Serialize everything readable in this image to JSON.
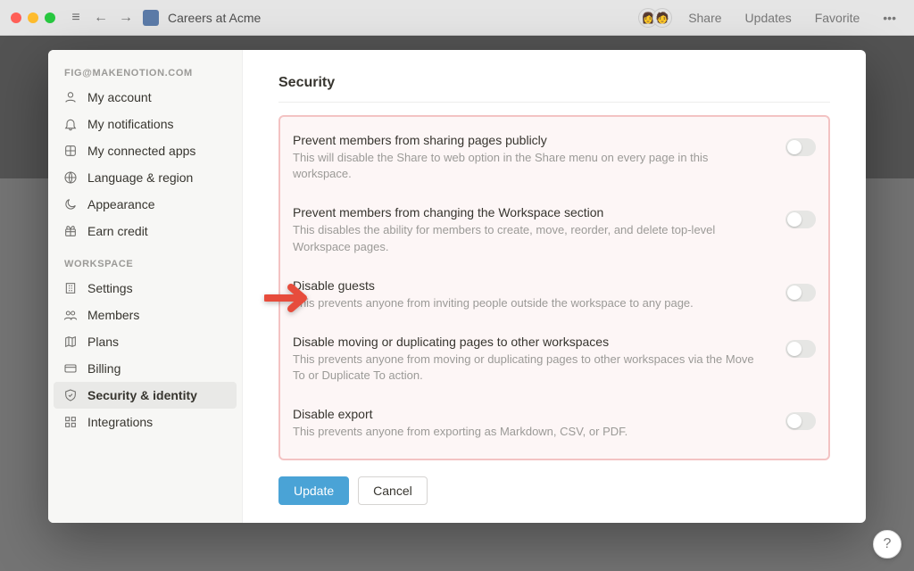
{
  "topbar": {
    "page_title": "Careers at Acme",
    "share": "Share",
    "updates": "Updates",
    "favorite": "Favorite"
  },
  "sidebar": {
    "account_header": "FIG@MAKENOTION.COM",
    "account_items": [
      {
        "icon": "user-circle-icon",
        "label": "My account"
      },
      {
        "icon": "bell-icon",
        "label": "My notifications"
      },
      {
        "icon": "app-grid-icon",
        "label": "My connected apps"
      },
      {
        "icon": "globe-icon",
        "label": "Language & region"
      },
      {
        "icon": "moon-icon",
        "label": "Appearance"
      },
      {
        "icon": "gift-icon",
        "label": "Earn credit"
      }
    ],
    "workspace_header": "WORKSPACE",
    "workspace_items": [
      {
        "icon": "building-icon",
        "label": "Settings"
      },
      {
        "icon": "people-icon",
        "label": "Members"
      },
      {
        "icon": "map-icon",
        "label": "Plans"
      },
      {
        "icon": "card-icon",
        "label": "Billing"
      },
      {
        "icon": "shield-icon",
        "label": "Security & identity"
      },
      {
        "icon": "integration-icon",
        "label": "Integrations"
      }
    ]
  },
  "main": {
    "title": "Security",
    "settings": [
      {
        "title": "Prevent members from sharing pages publicly",
        "desc": "This will disable the Share to web option in the Share menu on every page in this workspace.",
        "on": false
      },
      {
        "title": "Prevent members from changing the Workspace section",
        "desc": "This disables the ability for members to create, move, reorder, and delete top-level Workspace pages.",
        "on": false
      },
      {
        "title": "Disable guests",
        "desc": "This prevents anyone from inviting people outside the workspace to any page.",
        "on": false
      },
      {
        "title": "Disable moving or duplicating pages to other workspaces",
        "desc": "This prevents anyone from moving or duplicating pages to other workspaces via the Move To or Duplicate To action.",
        "on": false
      },
      {
        "title": "Disable export",
        "desc": "This prevents anyone from exporting as Markdown, CSV, or PDF.",
        "on": false
      }
    ],
    "update_label": "Update",
    "cancel_label": "Cancel"
  },
  "help_label": "?"
}
